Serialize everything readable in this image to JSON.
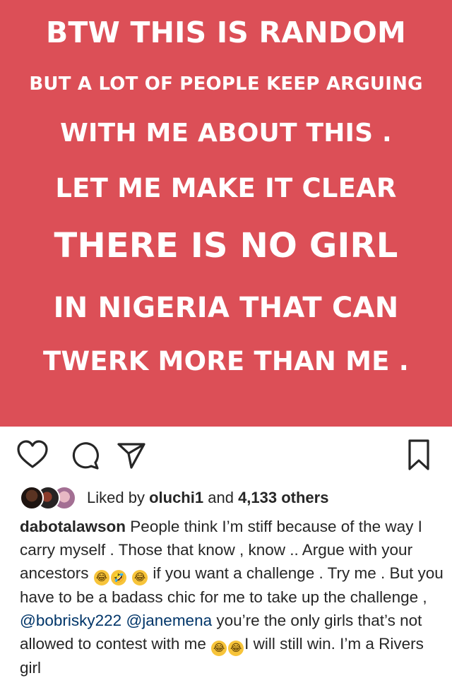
{
  "post": {
    "lines": [
      "BTW THIS IS RANDOM",
      "BUT A LOT OF PEOPLE KEEP ARGUING",
      "WITH ME ABOUT THIS .",
      "LET ME MAKE IT CLEAR",
      "THERE IS NO GIRL",
      "IN NIGERIA THAT CAN",
      "TWERK MORE THAN ME ."
    ],
    "background_color": "#dc4f57"
  },
  "actions": {
    "icons": [
      "heart-icon",
      "comment-icon",
      "share-icon",
      "bookmark-icon"
    ]
  },
  "likes": {
    "prefix": "Liked by",
    "user": "oluchi1",
    "middle": "and",
    "count": "4,133 others"
  },
  "caption": {
    "username": "dabotalawson",
    "part1": "People think I’m stiff because of the way I carry myself . Those that know , know .. Argue with your ancestors",
    "emoji1": "😂",
    "emoji2": "🤣",
    "emoji3": "😂",
    "part2": "if you want a challenge . Try me . But you have to be a badass chic for me to take up the challenge ,",
    "mention1": "@bobrisky222",
    "mention2": "@janemena",
    "part3": "you’re the only girls that’s not allowed to contest with me",
    "emoji4": "😂",
    "emoji5": "😂",
    "part4": "I will still win. I’m a Rivers girl"
  }
}
